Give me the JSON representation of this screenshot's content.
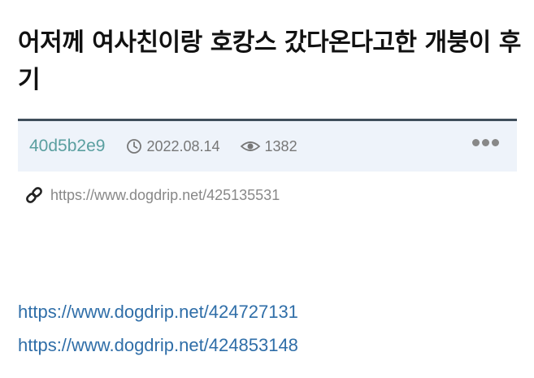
{
  "post": {
    "title": "어저께 여사친이랑 호캉스 갔다온다고한 개붕이 후기",
    "author": "40d5b2e9",
    "date": "2022.08.14",
    "views": "1382",
    "permalink": "https://www.dogdrip.net/425135531"
  },
  "body": {
    "links": [
      "https://www.dogdrip.net/424727131",
      "https://www.dogdrip.net/424853148"
    ]
  },
  "icons": {
    "date": "clock-icon",
    "views": "eye-icon",
    "permalink": "link-icon",
    "more": "more-dots-icon"
  },
  "colors": {
    "author": "#5a9fa0",
    "meta_bar_bg": "#eef3fa",
    "meta_bar_border": "#3f4e5b",
    "link": "#2f6ea8"
  }
}
